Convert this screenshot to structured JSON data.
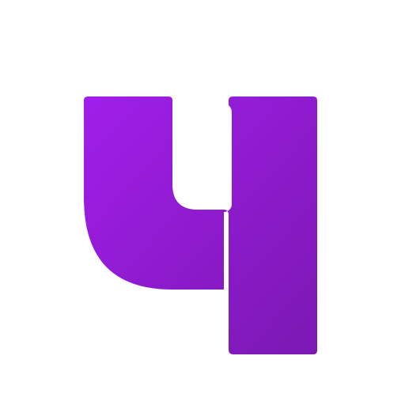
{
  "logo": {
    "name": "ч-letter-logo",
    "color_start": "#a11eea",
    "color_end": "#7b18b2",
    "background": "#ffffff"
  }
}
